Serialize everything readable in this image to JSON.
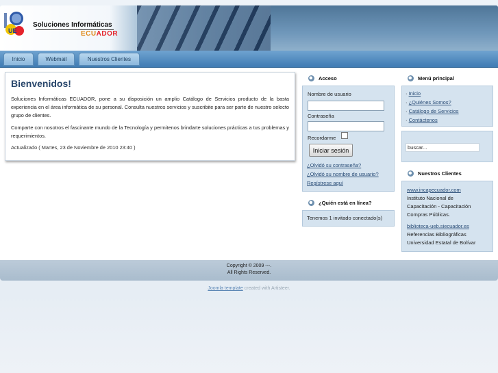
{
  "header": {
    "title": "Soluciones Informáticas",
    "subtitle_part1": "ECU",
    "subtitle_part2": "ADOR",
    "logo_letters": "UE"
  },
  "nav": {
    "tabs": [
      {
        "label": "Inicio"
      },
      {
        "label": "Webmail"
      },
      {
        "label": "Nuestros Clientes"
      }
    ]
  },
  "welcome": {
    "title": "Bienvenidos!",
    "paragraph1": "Soluciones Informáticas ECUADOR, pone a su disposición un amplio Catálogo de Servicios producto de la basta experiencia en el área informática de su personal. Consulta nuestros servicios y suscribite para ser parte de nuestro selecto grupo de clientes.",
    "paragraph2": "Comparte con nosotros el fascinante mundo de la Tecnología y permitenos brindarte soluciones prácticas a tus problemas y requerimientos.",
    "updated": "Actualizado ( Martes, 23 de Noviembre de 2010 23:40 )"
  },
  "login": {
    "heading": "Acceso",
    "username_label": "Nombre de usuario",
    "username_value": "",
    "password_label": "Contraseña",
    "password_value": "",
    "remember_label": "Recordarme",
    "submit_label": "Iniciar sesión",
    "forgot_password": "¿Olvidó su contraseña?",
    "forgot_username": "¿Olvidó su nombre de usuario?",
    "register": "Regístrese aquí"
  },
  "online": {
    "heading": "¿Quién está en línea?",
    "text": "Tenemos 1 invitado conectado(s)"
  },
  "main_menu": {
    "heading": "Menú principal",
    "items": [
      {
        "label": "Inicio"
      },
      {
        "label": "¿Quiénes Somos?"
      },
      {
        "label": "Catálogo de Servicios"
      },
      {
        "label": "Contáctenos"
      }
    ]
  },
  "search": {
    "value": "buscar..."
  },
  "clients": {
    "heading": "Nuestros Clientes",
    "entries": [
      {
        "link": "www.incapecuador.com",
        "line1": "Instituto Nacional de",
        "line2": "Capacitación - Capacitación",
        "line3": "Compras Públicas."
      },
      {
        "link": "biblioteca-ueb.siecuador.es",
        "line1": "Referencias Bibliográficas",
        "line2": "Universidad Estatal de Bolívar"
      }
    ]
  },
  "footer": {
    "copyright": "Copyright © 2009 ---.",
    "rights": "All Rights Reserved.",
    "credit_link": "Joomla template",
    "credit_rest": " created with Artisteer."
  },
  "colors": {
    "accent": "#27456a",
    "nav_blue": "#3f7bb3",
    "panel_bg": "#d5e3ef",
    "link": "#2a4d77",
    "logo_orange": "#e08a1a",
    "logo_red": "#e5222a"
  }
}
